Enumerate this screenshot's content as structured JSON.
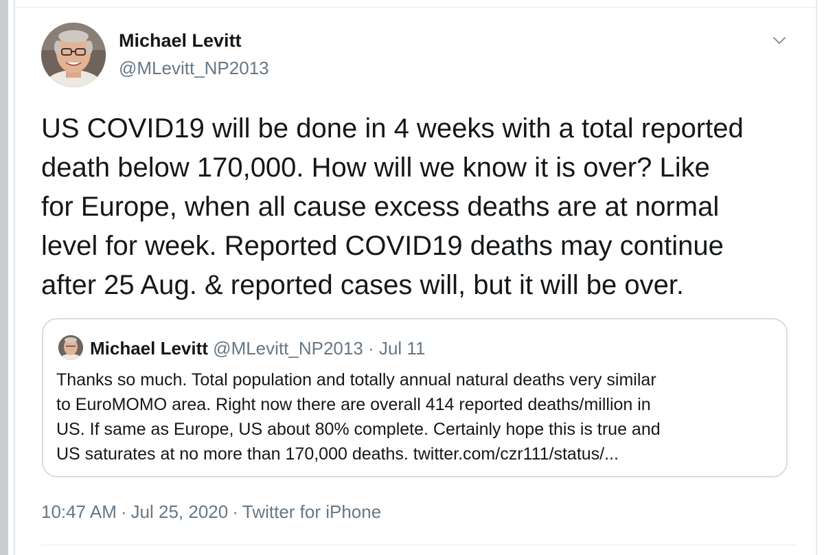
{
  "tweet": {
    "author_name": "Michael Levitt",
    "author_handle": "@MLevitt_NP2013",
    "more_icon": "chevron-down-icon",
    "text": "US COVID19 will be done in 4 weeks with a total reported\ndeath below 170,000. How will we know it is over?  Like\nfor  Europe, when all cause excess deaths are at normal\nlevel for week. Reported COVID19 deaths may continue\nafter 25 Aug. & reported cases will, but it will be over."
  },
  "quoted_tweet": {
    "author_name": "Michael Levitt",
    "author_handle": "@MLevitt_NP2013",
    "separator": "·",
    "date": "Jul 11",
    "text": "Thanks so much. Total population and totally annual natural deaths very similar\nto EuroMOMO area. Right now there are overall 414 reported deaths/million in\nUS. If same as Europe, US  about 80% complete. Certainly hope this is true and\nUS saturates at no more than 170,000 deaths. twitter.com/czr111/status/..."
  },
  "meta": {
    "time": "10:47 AM",
    "separator": "·",
    "date": "Jul 25, 2020",
    "source": "Twitter for iPhone"
  },
  "colors": {
    "text_primary": "#14171a",
    "text_secondary": "#657786",
    "border": "#d6dde3"
  }
}
